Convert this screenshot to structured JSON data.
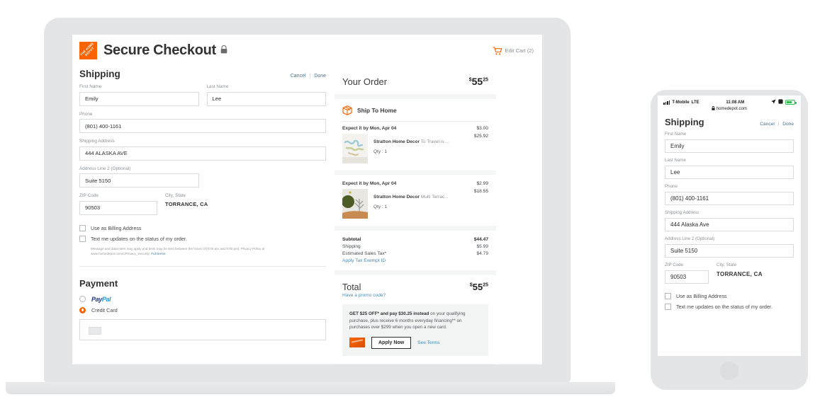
{
  "laptop": {
    "header": {
      "logo_text": "THE HOME DEPOT",
      "title": "Secure Checkout",
      "lock_icon": "lock-icon",
      "cart_icon": "shopping-cart-icon",
      "cart_label": "Edit Cart (2)"
    },
    "shipping": {
      "heading": "Shipping",
      "cancel_label": "Cancel",
      "separator": "|",
      "done_label": "Done",
      "fields": [
        {
          "label": "First Name",
          "value": "Emily"
        },
        {
          "label": "Last Name",
          "value": "Lee"
        },
        {
          "label": "Phone",
          "value": "(801) 400-1161"
        },
        {
          "label": "Shipping Address",
          "value": "444 ALASKA AVE"
        },
        {
          "label": "Address Line 2 (Optional)",
          "value": "Suite 5150"
        },
        {
          "label": "ZIP Code",
          "value": "90503"
        },
        {
          "label": "City, State",
          "value": "TORRANCE, CA"
        }
      ],
      "checkbox_billing": "Use as Billing Address",
      "checkbox_text_updates": "Text me updates on the status of my order.",
      "fineprint": "Message and data rates may apply and texts may be sent between the hours of [8:00 am and 9:00 pm]. Privacy Policy at www.homedepot.com/c/Privacy_Security.",
      "fineprint_link": "Full terms"
    },
    "payment": {
      "heading": "Payment",
      "paypal_label_1": "Pay",
      "paypal_label_2": "Pal",
      "credit_card_label": "Credit Card"
    },
    "order": {
      "title": "Your Order",
      "total_dollar_sign": "$",
      "total_whole": "55",
      "total_cents": "25",
      "ship_icon": "package-icon",
      "ship_method": "Ship To Home",
      "groups": [
        {
          "eta": "Expect it by Mon, Apr 04",
          "ship_price": "$3.00",
          "item_brand": "Stratton Home Decor",
          "item_name": " To Travel is ...",
          "item_qty": "Qty : 1",
          "item_price": "$25.92",
          "thumb": "world-map-print"
        },
        {
          "eta": "Expect it by Mon, Apr 04",
          "ship_price": "$2.99",
          "item_brand": "Stratton Home Decor",
          "item_name": " Multi Terrac...",
          "item_qty": "Qty : 1",
          "item_price": "$18.55",
          "thumb": "tree-art-print"
        }
      ],
      "lines": [
        {
          "label": "Subtotal",
          "value": "$44.47",
          "bold": true
        },
        {
          "label": "Shipping",
          "value": "$5.99",
          "bold": false
        },
        {
          "label": "Estimated Sales Tax*",
          "value": "$4.79",
          "bold": false
        }
      ],
      "tax_exempt_link": "Apply Tax Exempt ID",
      "total_label": "Total",
      "promo_link": "Have a promo code?",
      "offer_bold": "GET $25 OFF* and pay $30.25 instead",
      "offer_rest": " on your qualifying purchase, plus receive 6 months everyday financing** on purchases over $299 when you open a new card.",
      "apply_now": "Apply Now",
      "see_terms": "See Terms"
    }
  },
  "phone": {
    "status": {
      "carrier": "T-Mobile",
      "network": "LTE",
      "time": "11:08 AM",
      "location_icon": "location-arrow-icon",
      "alarm_icon": "alarm-icon",
      "battery_icon": "battery-icon",
      "lock_icon": "lock-icon",
      "url": "homedepot.com"
    },
    "heading": "Shipping",
    "cancel_label": "Cancel",
    "separator": "|",
    "done_label": "Done",
    "fields": [
      {
        "label": "First Name",
        "value": "Emily"
      },
      {
        "label": "Last Name",
        "value": "Lee"
      },
      {
        "label": "Phone",
        "value": "(801) 400-1161"
      },
      {
        "label": "Shipping Address",
        "value": "444 Alaska Ave"
      },
      {
        "label": "Address Line 2 (Optional)",
        "value": "Suite 5150"
      },
      {
        "label": "ZIP Code",
        "value": "90503"
      },
      {
        "label": "City, State",
        "value": "TORRANCE, CA"
      }
    ],
    "checkbox_billing": "Use as Billing Address",
    "checkbox_text_updates": "Text me updates on the status of my order."
  },
  "colors": {
    "brand_orange": "#f96302",
    "link_blue": "#3e7697",
    "device_gray": "#e4e5e6"
  }
}
